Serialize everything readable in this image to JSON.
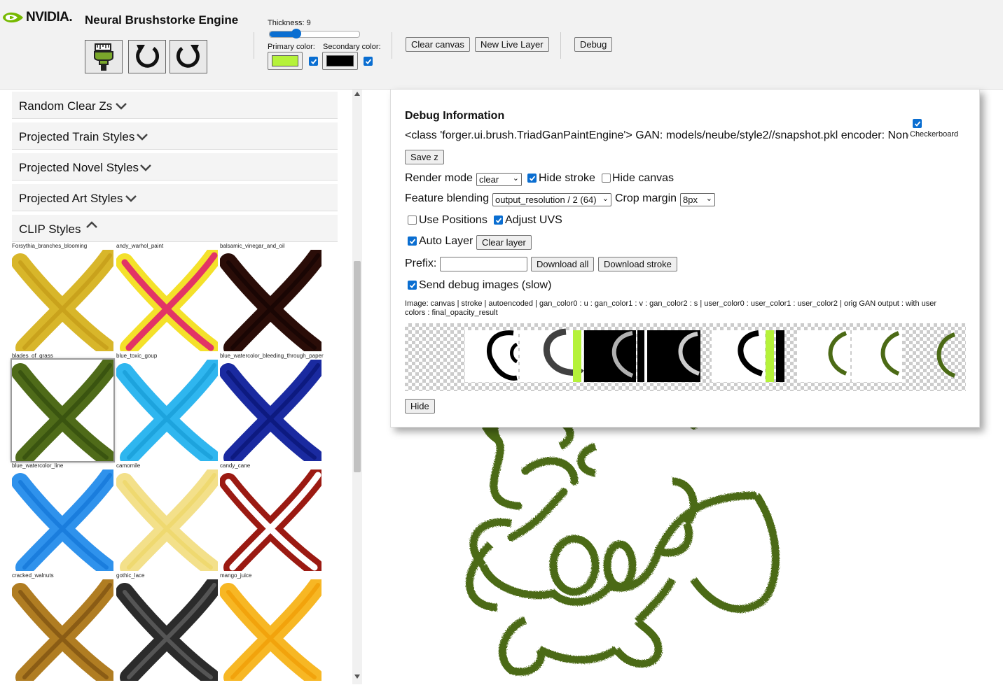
{
  "header": {
    "brand": "NVIDIA.",
    "title": "Neural Brushstorke Engine",
    "thickness_label": "Thickness: 9",
    "thickness_value": 9,
    "primary_label": "Primary color:",
    "secondary_label": "Secondary color:",
    "primary_color": "#b5f23a",
    "secondary_color": "#000000",
    "clear_canvas": "Clear canvas",
    "new_live_layer": "New Live Layer",
    "debug": "Debug"
  },
  "sidebar": {
    "sections": [
      {
        "label": "Random Clear Zs",
        "expanded": false
      },
      {
        "label": "Projected Train Styles",
        "expanded": false
      },
      {
        "label": "Projected Novel Styles",
        "expanded": false
      },
      {
        "label": "Projected Art Styles",
        "expanded": false
      },
      {
        "label": "CLIP Styles",
        "expanded": true
      }
    ],
    "styles": [
      {
        "name": "Forsythia_branches_blooming",
        "color": "#d8b62a",
        "accent": "#c9a21c"
      },
      {
        "name": "andy_warhol_paint",
        "color": "#f4e12a",
        "accent": "#e23466"
      },
      {
        "name": "balsamic_vinegar_and_oil",
        "color": "#2a0d08",
        "accent": "#1a0604"
      },
      {
        "name": "blades_of_grass",
        "color": "#4f6b19",
        "accent": "#3a5410"
      },
      {
        "name": "blue_toxic_goup",
        "color": "#2fb6ef",
        "accent": "#1da3dd"
      },
      {
        "name": "blue_watercolor_bleeding_through_paper",
        "color": "#1a2aa0",
        "accent": "#0d1a80"
      },
      {
        "name": "blue_watercolor_line",
        "color": "#2f92ec",
        "accent": "#1a7ddd"
      },
      {
        "name": "camomile",
        "color": "#f3e08a",
        "accent": "#efd970"
      },
      {
        "name": "candy_cane",
        "color": "#9b1a12",
        "accent": "#ffffff"
      },
      {
        "name": "cracked_walnuts",
        "color": "#b07d22",
        "accent": "#8a5c15"
      },
      {
        "name": "gothic_lace",
        "color": "#2b2b2b",
        "accent": "#555555"
      },
      {
        "name": "mango_juice",
        "color": "#f7b724",
        "accent": "#f2a30c"
      }
    ]
  },
  "debug_panel": {
    "title": "Debug Information",
    "info": "<class 'forger.ui.brush.TriadGanPaintEngine'> GAN: models/neube/style2//snapshot.pkl encoder: None",
    "checkerboard_label": "Checkerboard",
    "save_z": "Save z",
    "render_mode_label": "Render mode",
    "render_mode_value": "clear",
    "hide_stroke_label": "Hide stroke",
    "hide_canvas_label": "Hide canvas",
    "feature_blending_label": "Feature blending",
    "feature_blending_value": "output_resolution / 2 (64)",
    "crop_margin_label": "Crop margin",
    "crop_margin_value": "8px",
    "use_positions_label": "Use Positions",
    "adjust_uvs_label": "Adjust UVS",
    "auto_layer_label": "Auto Layer",
    "clear_layer": "Clear layer",
    "prefix_label": "Prefix:",
    "prefix_value": "",
    "download_all": "Download all",
    "download_stroke": "Download stroke",
    "send_debug_label": "Send debug images (slow)",
    "image_caption": "Image: canvas | stroke | autoencoded | gan_color0 : u : gan_color1 : v : gan_color2 : s | user_color0 : user_color1 : user_color2 | orig GAN output : with user colors : final_opacity_result",
    "hide": "Hide"
  },
  "colors": {
    "stroke_green": "#4b6a15",
    "checkbox_blue": "#0a6ed1"
  }
}
